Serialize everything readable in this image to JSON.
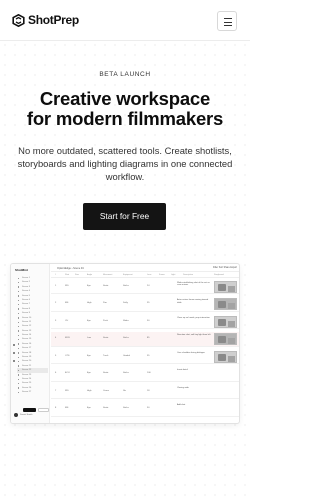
{
  "header": {
    "brand": "ShotPrep",
    "menu_icon": "hamburger-icon"
  },
  "hero": {
    "eyebrow": "BETA LAUNCH",
    "headline_line1": "Creative workspace",
    "headline_line2": "for modern filmmakers",
    "subtext": "No more outdated, scattered tools. Create shotlists, storyboards and lighting diagrams in one connected workflow.",
    "cta_label": "Start for Free"
  },
  "preview": {
    "note": "",
    "sidebar": {
      "brand": "ShotMint",
      "items": [
        "Scene 1",
        "Scene 2",
        "Scene 3",
        "Scene 4",
        "Scene 5",
        "Scene 6",
        "Scene 7",
        "Scene 8",
        "Scene 9",
        "Scene 10",
        "Scene 11",
        "Scene 12",
        "Scene 13",
        "Scene 14",
        "Scene 15",
        "Scene 16",
        "Scene 17",
        "Scene 18",
        "Scene 19",
        "Scene 20",
        "Scene 21",
        "Scene 22",
        "Scene 23",
        "Scene 24",
        "Scene 25",
        "Scene 26",
        "Scene 27"
      ],
      "user": "Daniel Smith"
    },
    "topbar": {
      "breadcrumb": "Option/Edge › Scene 04",
      "tools": "Filter  Sort  Share  Export"
    },
    "columns": [
      "#",
      "Shot",
      "Size",
      "Angle",
      "Movement",
      "Equipment",
      "Lens",
      "Frame",
      "Light",
      "Description",
      "Storyboard"
    ],
    "rows": [
      {
        "num": "1",
        "shot": "WS",
        "angle": "Eye",
        "move": "Static",
        "equip": "Sticks",
        "lens": "24",
        "desc": "Wide establishing shot of the set as crew arrives",
        "thumb": true
      },
      {
        "num": "2",
        "shot": "MS",
        "angle": "High",
        "move": "Pan",
        "equip": "Dolly",
        "lens": "35",
        "desc": "Actor enters frame moving toward table",
        "thumb": true
      },
      {
        "num": "3",
        "shot": "CU",
        "angle": "Eye",
        "move": "Push",
        "equip": "Slider",
        "lens": "50",
        "desc": "Close up on hands, prop interaction",
        "thumb": true
      },
      {
        "num": "4",
        "shot": "MCU",
        "angle": "Low",
        "move": "Static",
        "equip": "Sticks",
        "lens": "85",
        "desc": "Reaction shot, soft key light from left",
        "thumb": true
      },
      {
        "num": "5",
        "shot": "OTS",
        "angle": "Eye",
        "move": "Track",
        "equip": "Gimbal",
        "lens": "35",
        "desc": "Over shoulder during dialogue",
        "thumb": true
      },
      {
        "num": "6",
        "shot": "ECU",
        "angle": "Eye",
        "move": "Static",
        "equip": "Sticks",
        "lens": "100",
        "desc": "Insert detail",
        "thumb": false
      },
      {
        "num": "7",
        "shot": "WS",
        "angle": "High",
        "move": "Crane",
        "equip": "Jib",
        "lens": "18",
        "desc": "Closing wide",
        "thumb": false
      },
      {
        "num": "8",
        "shot": "MS",
        "angle": "Eye",
        "move": "Static",
        "equip": "Sticks",
        "lens": "50",
        "desc": "Add shot",
        "thumb": false
      }
    ]
  },
  "colors": {
    "accent": "#141414",
    "background": "#ffffff",
    "dot_grid": "#d9d9d9"
  }
}
